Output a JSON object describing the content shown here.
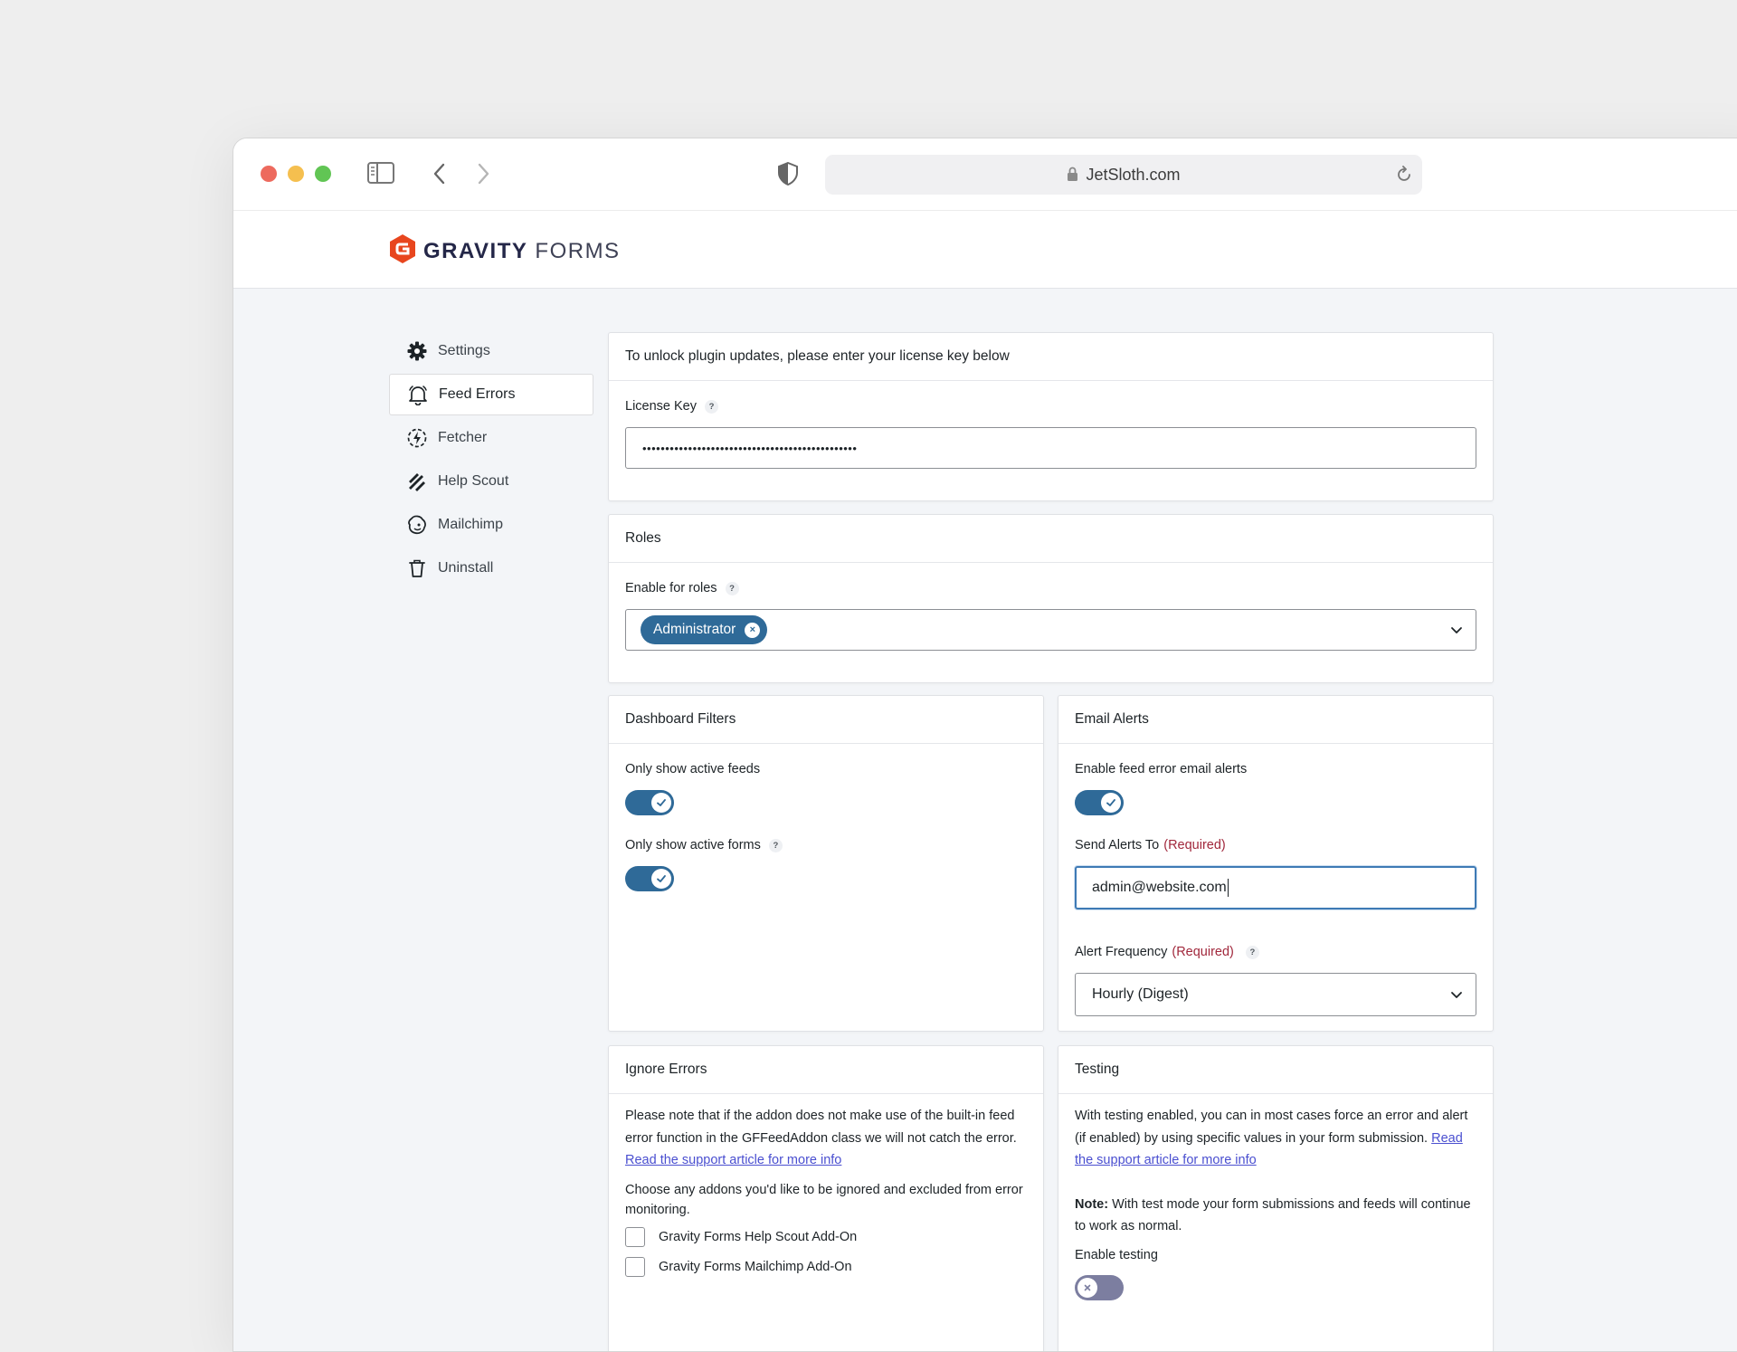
{
  "browser": {
    "url": "JetSloth.com"
  },
  "brand": {
    "part1": "GRAVITY",
    "part2": "FORMS"
  },
  "sidebar": {
    "items": [
      {
        "label": "Settings",
        "icon": "gear-icon"
      },
      {
        "label": "Feed Errors",
        "icon": "bell-icon"
      },
      {
        "label": "Fetcher",
        "icon": "fetch-icon"
      },
      {
        "label": "Help Scout",
        "icon": "helpscout-icon"
      },
      {
        "label": "Mailchimp",
        "icon": "mailchimp-icon"
      },
      {
        "label": "Uninstall",
        "icon": "trash-icon"
      }
    ]
  },
  "license": {
    "heading": "To unlock plugin updates, please enter your license key below",
    "field_label": "License Key",
    "help": "?",
    "value": "•••••••••••••••••••••••••••••••••••••••••••••••"
  },
  "roles": {
    "heading": "Roles",
    "field_label": "Enable for roles",
    "help": "?",
    "chip": "Administrator",
    "chip_remove": "×"
  },
  "dashboard_filters": {
    "heading": "Dashboard Filters",
    "active_feeds_label": "Only show active feeds",
    "active_forms_label": "Only show active forms",
    "help": "?"
  },
  "email_alerts": {
    "heading": "Email Alerts",
    "enable_label": "Enable feed error email alerts",
    "send_to_label": "Send Alerts To",
    "required": "(Required)",
    "send_to_value": "admin@website.com",
    "frequency_label": "Alert Frequency",
    "help": "?",
    "frequency_value": "Hourly (Digest)"
  },
  "ignore_errors": {
    "heading": "Ignore Errors",
    "para1": "Please note that if the addon does not make use of the built-in feed error function in the GFFeedAddon class we will not catch the error.",
    "para1_link": "Read the support article for more info",
    "para2": "Choose any addons you'd like to be ignored and excluded from error monitoring.",
    "addons": [
      "Gravity Forms Help Scout Add-On",
      "Gravity Forms Mailchimp Add-On"
    ]
  },
  "testing": {
    "heading": "Testing",
    "para1": "With testing enabled, you can in most cases force an error and alert (if enabled) by using specific values in your form submission.",
    "para1_link": "Read the support article for more info",
    "note_label": "Note:",
    "note_text": "With test mode your form submissions and feeds will continue to work as normal.",
    "enable_label": "Enable testing"
  },
  "colors": {
    "accent": "#2f6a98",
    "required": "#a1283c",
    "link": "#4a4fd0",
    "logo": "#e8461e"
  }
}
